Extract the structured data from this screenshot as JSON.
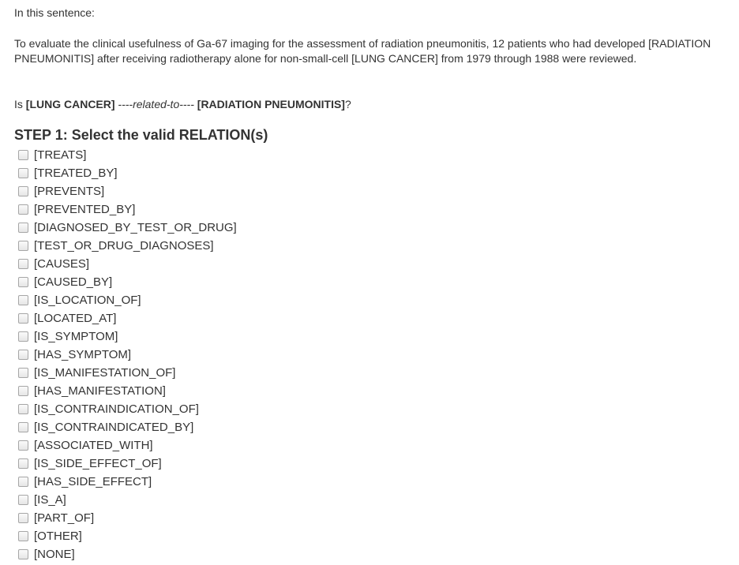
{
  "intro": "In this sentence:",
  "sentence": "To evaluate the clinical usefulness of Ga-67 imaging for the assessment of radiation pneumonitis, 12 patients who had developed [RADIATION PNEUMONITIS] after receiving radiotherapy alone for non-small-cell [LUNG CANCER] from 1979 through 1988 were reviewed.",
  "question": {
    "prefix": "Is ",
    "entity1": "[LUNG CANCER]",
    "relation": " ----related-to---- ",
    "entity2": "[RADIATION PNEUMONITIS]",
    "suffix": "?"
  },
  "step1": {
    "title": "STEP 1: Select the valid RELATION(s)",
    "relations": [
      {
        "label": "[TREATS]",
        "checked": false
      },
      {
        "label": "[TREATED_BY]",
        "checked": false
      },
      {
        "label": "[PREVENTS]",
        "checked": false
      },
      {
        "label": "[PREVENTED_BY]",
        "checked": false
      },
      {
        "label": "[DIAGNOSED_BY_TEST_OR_DRUG]",
        "checked": false
      },
      {
        "label": "[TEST_OR_DRUG_DIAGNOSES]",
        "checked": false
      },
      {
        "label": "[CAUSES]",
        "checked": false
      },
      {
        "label": "[CAUSED_BY]",
        "checked": false
      },
      {
        "label": "[IS_LOCATION_OF]",
        "checked": false
      },
      {
        "label": "[LOCATED_AT]",
        "checked": false
      },
      {
        "label": "[IS_SYMPTOM]",
        "checked": false
      },
      {
        "label": "[HAS_SYMPTOM]",
        "checked": false
      },
      {
        "label": "[IS_MANIFESTATION_OF]",
        "checked": false
      },
      {
        "label": "[HAS_MANIFESTATION]",
        "checked": false
      },
      {
        "label": "[IS_CONTRAINDICATION_OF]",
        "checked": false
      },
      {
        "label": "[IS_CONTRAINDICATED_BY]",
        "checked": false
      },
      {
        "label": "[ASSOCIATED_WITH]",
        "checked": false
      },
      {
        "label": "[IS_SIDE_EFFECT_OF]",
        "checked": false
      },
      {
        "label": "[HAS_SIDE_EFFECT]",
        "checked": false
      },
      {
        "label": "[IS_A]",
        "checked": false
      },
      {
        "label": "[PART_OF]",
        "checked": false
      },
      {
        "label": "[OTHER]",
        "checked": false
      },
      {
        "label": "[NONE]",
        "checked": false
      }
    ]
  }
}
